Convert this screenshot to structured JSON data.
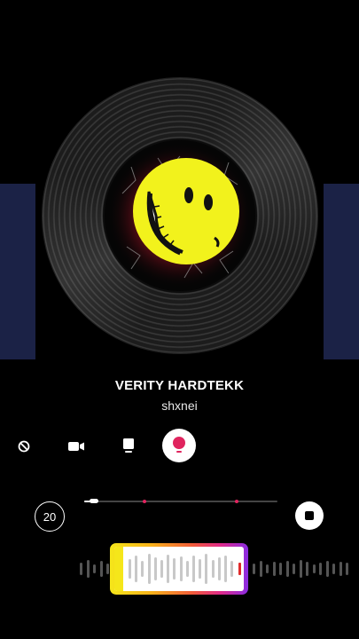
{
  "track": {
    "title": "VERITY HARDTEKK",
    "artist": "shxnei"
  },
  "cover_art": {
    "subject": "smiley-face-icon",
    "colors": {
      "face": "#f2f21c",
      "glow": "#c0152a",
      "background": "#050505"
    }
  },
  "modes": [
    {
      "name": "no-camera",
      "icon": "cancel-icon",
      "selected": false
    },
    {
      "name": "video",
      "icon": "video-camera-icon",
      "selected": false
    },
    {
      "name": "photo",
      "icon": "portrait-photo-icon",
      "selected": false
    },
    {
      "name": "record",
      "icon": "microphone-icon",
      "selected": true
    }
  ],
  "timer": {
    "label": "20"
  },
  "progress": {
    "fraction": 0.05,
    "markers": [
      0.31,
      0.79
    ]
  },
  "trim_selection": {
    "start_fraction": 0.11,
    "end_fraction": 0.61,
    "playhead_fraction": 0.97
  },
  "colors": {
    "accent_red": "#e0245e",
    "side_panel": "#1b2246",
    "selector_gradient": [
      "#f5e61a",
      "#f9b21a",
      "#f15a3a",
      "#e02a8a",
      "#8a2be2"
    ]
  }
}
